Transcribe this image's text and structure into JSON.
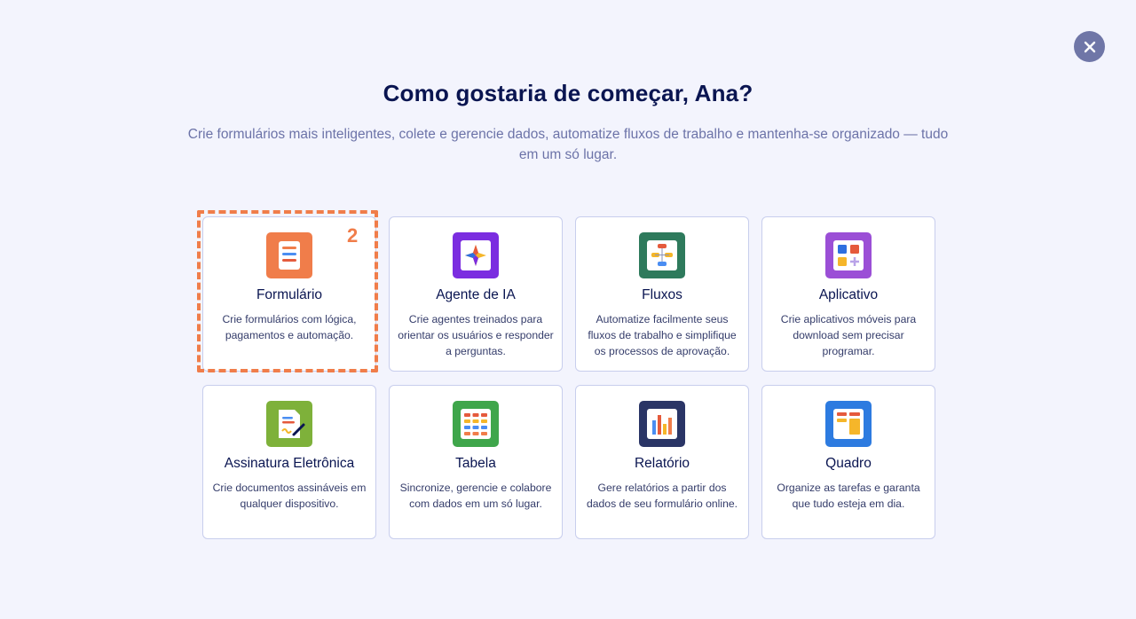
{
  "dialog": {
    "title": "Como gostaria de começar, Ana?",
    "subtitle": "Crie formulários mais inteligentes, colete e gerencie dados, automatize fluxos de trabalho e mantenha-se organizado — tudo em um só lugar.",
    "close_icon": "close-icon",
    "step_marker": "2"
  },
  "cards": [
    {
      "title": "Formulário",
      "desc": "Crie formulários com lógica, pagamentos e automação.",
      "icon": "form-icon",
      "color": "#f07d4a"
    },
    {
      "title": "Agente de IA",
      "desc": "Crie agentes treinados para orientar os usuários e responder a perguntas.",
      "icon": "ai-agent-icon",
      "color": "#7b2de0"
    },
    {
      "title": "Fluxos",
      "desc": "Automatize facilmente seus fluxos de trabalho e simplifique os processos de aprovação.",
      "icon": "workflow-icon",
      "color": "#2e7a5c"
    },
    {
      "title": "Aplicativo",
      "desc": "Crie aplicativos móveis para download sem precisar programar.",
      "icon": "app-icon",
      "color": "#9b4fd6"
    },
    {
      "title": "Assinatura Eletrônica",
      "desc": "Crie documentos assináveis em qualquer dispositivo.",
      "icon": "signature-icon",
      "color": "#7eb13a"
    },
    {
      "title": "Tabela",
      "desc": "Sincronize, gerencie e colabore com dados em um só lugar.",
      "icon": "table-icon",
      "color": "#3fa64b"
    },
    {
      "title": "Relatório",
      "desc": "Gere relatórios a partir dos dados de seu formulário online.",
      "icon": "report-icon",
      "color": "#2a3566"
    },
    {
      "title": "Quadro",
      "desc": "Organize as tarefas e garanta que tudo esteja em dia.",
      "icon": "board-icon",
      "color": "#2d7be0"
    }
  ]
}
